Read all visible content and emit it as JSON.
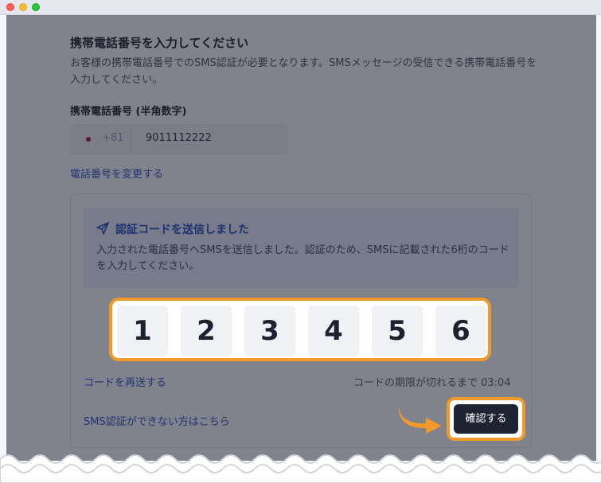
{
  "page": {
    "heading": "携帯電話番号を入力してください",
    "description": "お客様の携帯電話番号でのSMS認証が必要となります。SMSメッセージの受信できる携帯電話番号を入力してください。"
  },
  "phone": {
    "label": "携帯電話番号 (半角数字)",
    "country_code": "+81",
    "number": "9011112222",
    "change_link": "電話番号を変更する"
  },
  "notice": {
    "icon": "send-icon",
    "title": "認証コードを送信しました",
    "text": "入力された電話番号へSMSを送信しました。認証のため、SMSに記載された6桁のコードを入力してください。"
  },
  "code": {
    "digits": [
      "1",
      "2",
      "3",
      "4",
      "5",
      "6"
    ]
  },
  "actions": {
    "resend_link": "コードを再送する",
    "expiry_text": "コードの期限が切れるまで 03:04",
    "help_link": "SMS認証ができない方はこちら",
    "confirm_label": "確認する"
  },
  "colors": {
    "highlight": "#f09a2c",
    "link": "#2c4fc4",
    "button": "#1f2432"
  }
}
